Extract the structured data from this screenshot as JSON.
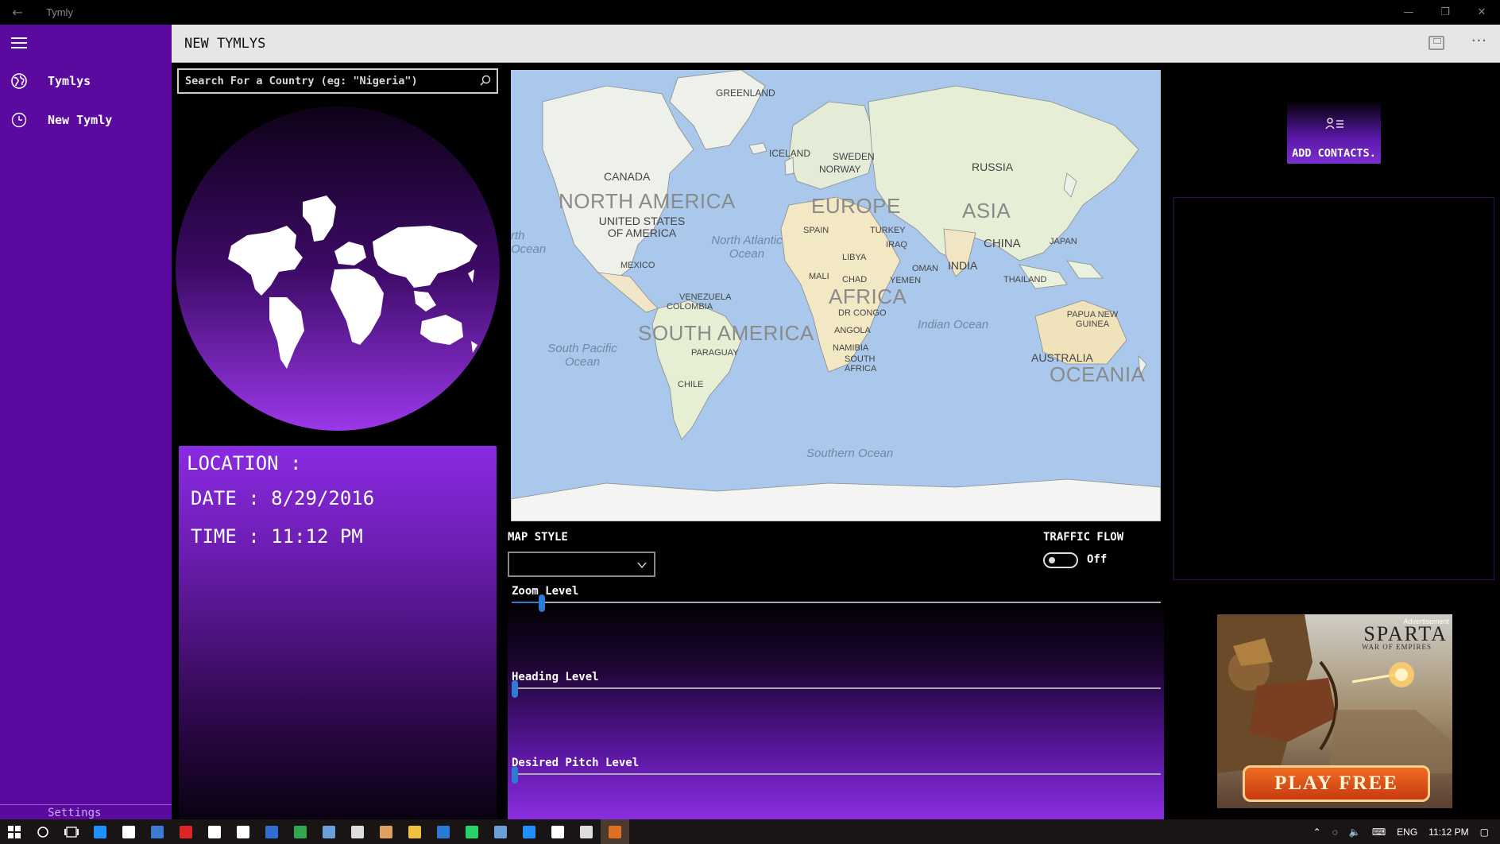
{
  "window": {
    "title": "Tymly"
  },
  "sidebar": {
    "items": [
      {
        "label": "Tymlys",
        "icon": "globe-icon"
      },
      {
        "label": "New Tymly",
        "icon": "clock-icon"
      }
    ],
    "settings_label": "Settings"
  },
  "header": {
    "title": "NEW TYMLYS"
  },
  "search": {
    "placeholder": "Search For a Country (eg: \"Nigeria\")",
    "value": ""
  },
  "info": {
    "location": "LOCATION :",
    "date": "DATE : 8/29/2016",
    "time": "TIME : 11:12 PM"
  },
  "map": {
    "continents": [
      "NORTH AMERICA",
      "SOUTH AMERICA",
      "EUROPE",
      "AFRICA",
      "ASIA",
      "OCEANIA"
    ],
    "countries": [
      "GREENLAND",
      "ICELAND",
      "SWEDEN",
      "NORWAY",
      "RUSSIA",
      "CANADA",
      "UNITED STATES OF AMERICA",
      "MEXICO",
      "SPAIN",
      "TURKEY",
      "IRAQ",
      "LIBYA",
      "CHINA",
      "JAPAN",
      "INDIA",
      "OMAN",
      "YEMEN",
      "THAILAND",
      "MALI",
      "CHAD",
      "DR CONGO",
      "ANGOLA",
      "NAMIBIA",
      "SOUTH AFRICA",
      "VENEZUELA",
      "COLOMBIA",
      "PARAGUAY",
      "CHILE",
      "PAPUA NEW GUINEA",
      "AUSTRALIA"
    ],
    "oceans": [
      "North Atlantic Ocean",
      "South Pacific Ocean",
      "Indian Ocean",
      "Southern Ocean",
      "rth Ocean"
    ]
  },
  "controls": {
    "map_style_label": "MAP STYLE",
    "map_style_value": "",
    "traffic_label": "TRAFFIC FLOW",
    "traffic_state": "Off",
    "traffic_on": false,
    "sliders": [
      {
        "label": "Zoom Level",
        "value": 0.047
      },
      {
        "label": "Heading Level",
        "value": 0.0
      },
      {
        "label": "Desired Pitch Level",
        "value": 0.0
      }
    ]
  },
  "contacts": {
    "button_label": "ADD CONTACTS."
  },
  "ad": {
    "tag": "Advertisement",
    "title": "SPARTA",
    "subtitle": "WAR OF EMPIRES",
    "cta": "PLAY FREE"
  },
  "taskbar": {
    "language": "ENG",
    "clock": "11:12 PM",
    "app_colors": [
      "#1e90ff",
      "#ffffff",
      "#3a7bd5",
      "#e02424",
      "#ffffff",
      "#ffffff",
      "#2f6fd0",
      "#2fa84f",
      "#6aa0d8",
      "#dddddd",
      "#e0a060",
      "#f0c040",
      "#2a7ad6",
      "#25d366",
      "#6aa0d8",
      "#1e90ff",
      "#ffffff",
      "#dddddd",
      "#e07020"
    ]
  },
  "colors": {
    "sidebar": "#5b0aa0",
    "accent": "#8a2be2",
    "slider": "#2e7bd6"
  }
}
